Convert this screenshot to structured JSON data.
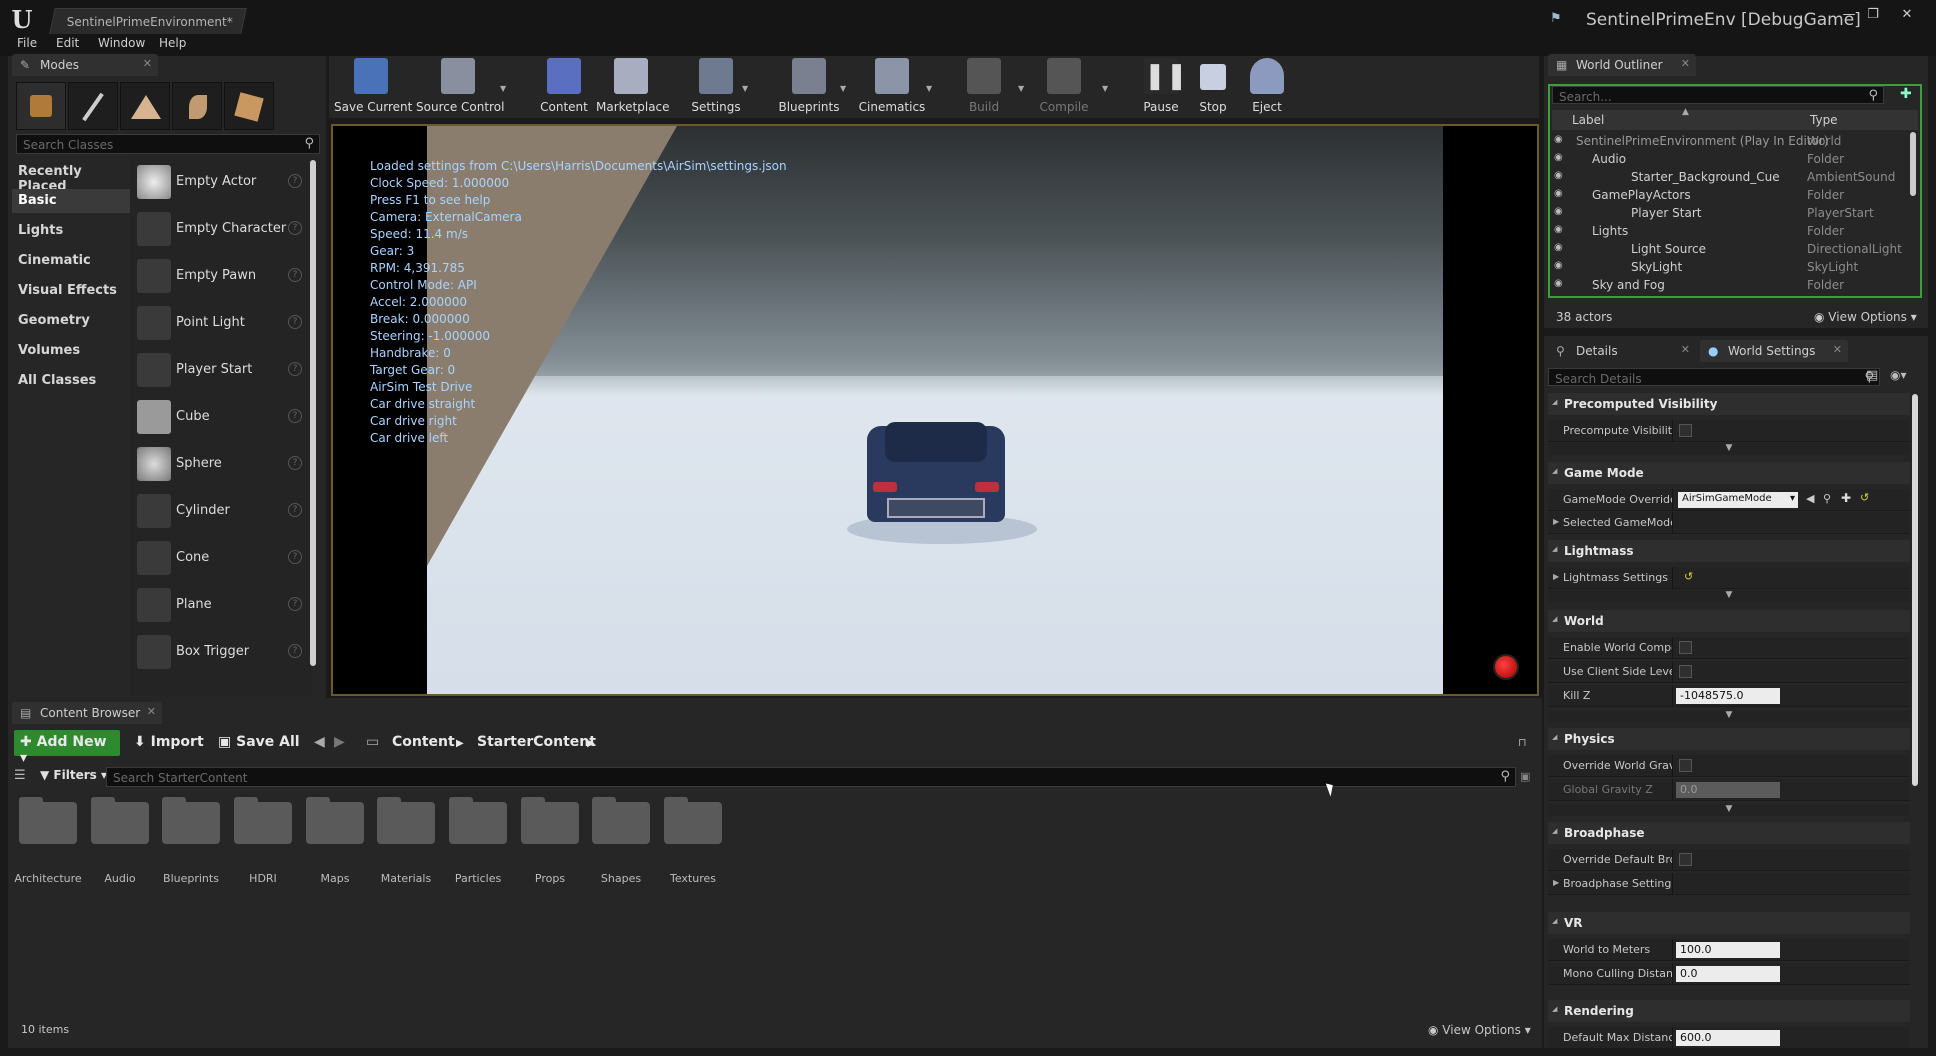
{
  "window": {
    "doc_tab": "SentinelPrimeEnvironment*",
    "project_title": "SentinelPrimeEnv [DebugGame]",
    "controls": [
      "—",
      "❐",
      "✕"
    ]
  },
  "menu": [
    "File",
    "Edit",
    "Window",
    "Help"
  ],
  "modes": {
    "tab": "Modes",
    "search_placeholder": "Search Classes",
    "categories": [
      "Recently Placed",
      "Basic",
      "Lights",
      "Cinematic",
      "Visual Effects",
      "Geometry",
      "Volumes",
      "All Classes"
    ],
    "selected_category": "Basic",
    "items": [
      "Empty Actor",
      "Empty Character",
      "Empty Pawn",
      "Point Light",
      "Player Start",
      "Cube",
      "Sphere",
      "Cylinder",
      "Cone",
      "Plane",
      "Box Trigger"
    ]
  },
  "toolbar": {
    "buttons": [
      "Save Current",
      "Source Control",
      "Content",
      "Marketplace",
      "Settings",
      "Blueprints",
      "Cinematics",
      "Build",
      "Compile",
      "Pause",
      "Stop",
      "Eject"
    ]
  },
  "viewport": {
    "hud_lines": [
      "Loaded settings from C:\\Users\\Harris\\Documents\\AirSim\\settings.json",
      "Clock Speed: 1.000000",
      "Press F1 to see help",
      "Camera: ExternalCamera",
      "Speed: 11.4 m/s",
      "Gear: 3",
      "RPM: 4,391.785",
      "Control Mode: API",
      "Accel: 2.000000",
      "Break: 0.000000",
      "Steering: -1.000000",
      "Handbrake: 0",
      "Target Gear: 0",
      "AirSim Test Drive",
      "Car drive straight",
      "Car drive right",
      "Car drive left"
    ]
  },
  "content_browser": {
    "tab": "Content Browser",
    "add_new": "Add New",
    "import": "Import",
    "save_all": "Save All",
    "breadcrumb": [
      "Content",
      "StarterContent"
    ],
    "filters": "Filters",
    "search_placeholder": "Search StarterContent",
    "folders": [
      "Architecture",
      "Audio",
      "Blueprints",
      "HDRI",
      "Maps",
      "Materials",
      "Particles",
      "Props",
      "Shapes",
      "Textures"
    ],
    "item_count": "10 items",
    "view_options": "View Options"
  },
  "outliner": {
    "tab": "World Outliner",
    "search_placeholder": "Search...",
    "col_label": "Label",
    "col_type": "Type",
    "rows": [
      {
        "label": "SentinelPrimeEnvironment (Play In Editor)",
        "type": "World",
        "indent": 0
      },
      {
        "label": "Audio",
        "type": "Folder",
        "indent": 1
      },
      {
        "label": "Starter_Background_Cue",
        "type": "AmbientSound",
        "indent": 2
      },
      {
        "label": "GamePlayActors",
        "type": "Folder",
        "indent": 1
      },
      {
        "label": "Player Start",
        "type": "PlayerStart",
        "indent": 2
      },
      {
        "label": "Lights",
        "type": "Folder",
        "indent": 1
      },
      {
        "label": "Light Source",
        "type": "DirectionalLight",
        "indent": 2
      },
      {
        "label": "SkyLight",
        "type": "SkyLight",
        "indent": 2
      },
      {
        "label": "Sky and Fog",
        "type": "Folder",
        "indent": 1
      }
    ],
    "actor_count": "38 actors",
    "view_options": "View Options"
  },
  "details": {
    "tab_details": "Details",
    "tab_world_settings": "World Settings",
    "search_placeholder": "Search Details",
    "sections": {
      "precomputed_visibility": "Precomputed Visibility",
      "precompute_visibility": "Precompute Visibility",
      "game_mode": "Game Mode",
      "gamemode_override": "GameMode Override",
      "gamemode_value": "AirSimGameMode",
      "selected_gamemode": "Selected GameMode",
      "lightmass": "Lightmass",
      "lightmass_settings": "Lightmass Settings",
      "world": "World",
      "enable_world_composition": "Enable World Composition",
      "use_client_side_level": "Use Client Side Level Streaming",
      "kill_z": "Kill Z",
      "kill_z_value": "-1048575.0",
      "physics": "Physics",
      "override_world_gravity": "Override World Gravity",
      "global_gravity_z": "Global Gravity Z",
      "global_gravity_value": "0.0",
      "broadphase": "Broadphase",
      "override_default_broadphase": "Override Default Broadphase",
      "broadphase_settings": "Broadphase Settings",
      "vr": "VR",
      "world_to_meters": "World to Meters",
      "world_to_meters_value": "100.0",
      "mono_culling_distance": "Mono Culling Distance",
      "mono_culling_value": "0.0",
      "rendering": "Rendering",
      "default_max_distance": "Default Max Distance Field",
      "default_max_distance_value": "600.0"
    }
  }
}
